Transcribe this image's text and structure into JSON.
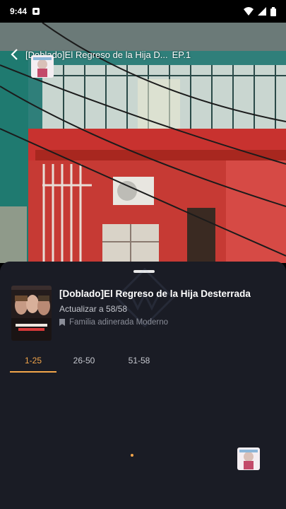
{
  "status_bar": {
    "time": "9:44"
  },
  "player": {
    "title": "[Doblado]El Regreso de la Hija D...",
    "episode": "EP.1"
  },
  "series": {
    "title": "[Doblado]El Regreso de la Hija Desterrada",
    "update": "Actualizar a 58/58",
    "tags": "Familia adinerada   Moderno"
  },
  "episode_ranges": [
    {
      "label": "1-25",
      "active": true
    },
    {
      "label": "26-50",
      "active": false
    },
    {
      "label": "51-58",
      "active": false
    }
  ],
  "colors": {
    "accent": "#f2a54a",
    "sheet_bg": "#1a1c25"
  }
}
